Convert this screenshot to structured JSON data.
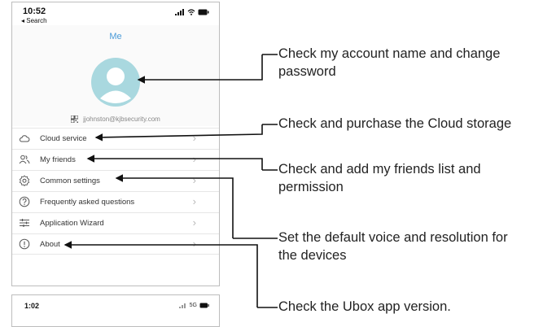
{
  "status_bar": {
    "time": "10:52",
    "back_label": "◂ Search"
  },
  "nav": {
    "title": "Me"
  },
  "account": {
    "email": "jjohnston@kjbsecurity.com"
  },
  "menu": {
    "items": [
      {
        "label": "Cloud service",
        "icon": "cloud-icon"
      },
      {
        "label": "My friends",
        "icon": "friends-icon"
      },
      {
        "label": "Common settings",
        "icon": "gear-icon"
      },
      {
        "label": "Frequently asked questions",
        "icon": "question-icon"
      },
      {
        "label": "Application Wizard",
        "icon": "sliders-icon"
      },
      {
        "label": "About",
        "icon": "info-icon"
      }
    ]
  },
  "second_phone": {
    "time": "1:02",
    "network": "5G"
  },
  "callouts": {
    "account_line1": "Check my account name and change",
    "account_line2": "password",
    "cloud": "Check and purchase the Cloud storage",
    "friends_line1": "Check and add my friends list and",
    "friends_line2": "permission",
    "settings_line1": "Set the default voice and resolution for",
    "settings_line2": "the devices",
    "about": "Check the Ubox app version."
  },
  "colors": {
    "accent": "#4a9bd8",
    "avatar": "#a9d8df"
  }
}
